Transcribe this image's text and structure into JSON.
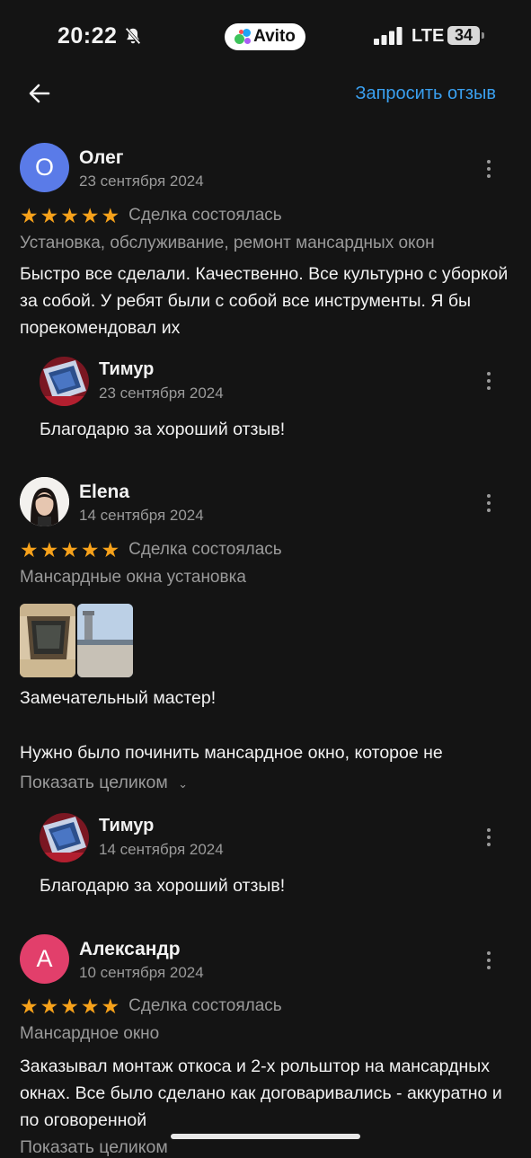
{
  "status_bar": {
    "time": "20:22",
    "app_badge": "Avito",
    "network": "LTE",
    "battery": "34"
  },
  "nav": {
    "back_icon": "arrow-left-icon",
    "request_review": "Запросить отзыв"
  },
  "colors": {
    "accent_link": "#3aa0f0",
    "star": "#f7a21b",
    "avatar_oleg": "#5a7be8",
    "avatar_alexandr": "#e23f6b",
    "background": "#141414"
  },
  "reviews": [
    {
      "initial": "О",
      "name": "Олег",
      "date": "23 сентября 2024",
      "rating": 5,
      "deal_status": "Сделка состоялась",
      "service": "Установка, обслуживание, ремонт мансардных окон",
      "text": "Быстро все сделали. Качественно. Все культурно с уборкой за собой. У ребят были с собой  все инструменты. Я бы порекомендовал их",
      "reply": {
        "name": "Тимур",
        "date": "23 сентября 2024",
        "text": "Благодарю за хороший отзыв!"
      }
    },
    {
      "initial": "",
      "name": "Elena",
      "date": "14 сентября 2024",
      "rating": 5,
      "deal_status": "Сделка состоялась",
      "service": "Мансардные окна установка",
      "text_line1": "Замечательный мастер!",
      "text_line2": "Нужно было починить мансардное окно, которое не",
      "show_more": "Показать целиком",
      "reply": {
        "name": "Тимур",
        "date": "14 сентября 2024",
        "text": "Благодарю за хороший отзыв!"
      }
    },
    {
      "initial": "А",
      "name": "Александр",
      "date": "10 сентября 2024",
      "rating": 5,
      "deal_status": "Сделка состоялась",
      "service": "Мансардное окно",
      "text": "Заказывал монтаж откоса и 2-х рольштор на мансардных окнах. Все было сделано как договаривались - аккуратно и по оговоренной",
      "show_more": "Показать целиком"
    }
  ]
}
